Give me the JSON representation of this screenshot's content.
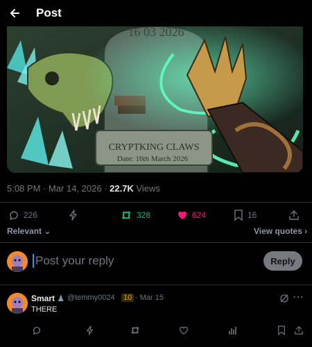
{
  "header": {
    "title": "Post"
  },
  "media": {
    "stone_date": "16 03 2026",
    "plaque_title": "CRYPTKING CLAWS",
    "plaque_date": "Date: 16th March 2026"
  },
  "meta": {
    "time": "5:08 PM · Mar 14, 2026 · ",
    "views_count": "22.7K",
    "views_label": " Views"
  },
  "actions": {
    "replies": "226",
    "reposts": "328",
    "likes": "624",
    "bookmarks": "16"
  },
  "sort": {
    "relevant": "Relevant",
    "view_quotes": "View quotes"
  },
  "composer": {
    "placeholder": "Post your reply",
    "reply_button": "Reply"
  },
  "reply": {
    "name": "Smart",
    "handle": "@temmy0024",
    "badge": "10",
    "date": "· Mar 15",
    "text": "THERE"
  },
  "colors": {
    "repost": "#00ba7c",
    "like": "#f91880",
    "accent": "#1d9bf0"
  }
}
